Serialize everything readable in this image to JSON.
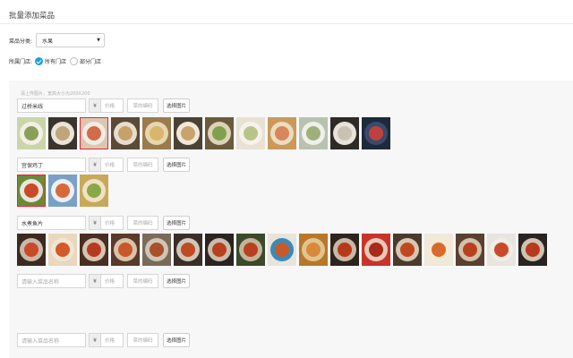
{
  "page": {
    "title": "批量添加菜品"
  },
  "category": {
    "label": "菜品分类:",
    "value": "水果"
  },
  "store": {
    "label": "所属门店:",
    "options": [
      "所有门店",
      "部分门店"
    ],
    "selected": 0
  },
  "hint": "请上传图片，宽高大小为200X200",
  "common": {
    "yen": "¥",
    "price_placeholder": "价格",
    "code_placeholder": "菜的编码",
    "pick_label": "选择图片"
  },
  "dishes": [
    {
      "name": "过桥米线",
      "placeholder": false,
      "selected_thumb": 2,
      "thumbs": [
        {
          "bg": "#c9d6a8",
          "plate": "#f2efe6",
          "food": "#8aa05a"
        },
        {
          "bg": "#3a342c",
          "plate": "#e9e4d7",
          "food": "#bfa57a"
        },
        {
          "bg": "#d8c8b0",
          "plate": "#f0ece4",
          "food": "#d36a4a"
        },
        {
          "bg": "#5b4a36",
          "plate": "#e7ddcf",
          "food": "#c8a06a"
        },
        {
          "bg": "#9a7b4e",
          "plate": "#e6d5b0",
          "food": "#d9b66a"
        },
        {
          "bg": "#4b4236",
          "plate": "#f0e8da",
          "food": "#c9a36d"
        },
        {
          "bg": "#6b5a3c",
          "plate": "#dcd2b8",
          "food": "#7fa04c"
        },
        {
          "bg": "#e8e2d4",
          "plate": "#f6f2ea",
          "food": "#b9c48a"
        },
        {
          "bg": "#c99a5a",
          "plate": "#ecdcc0",
          "food": "#d9865a"
        },
        {
          "bg": "#b8c2b0",
          "plate": "#eef0ea",
          "food": "#9fb07a"
        },
        {
          "bg": "#2e2a26",
          "plate": "#e7e3dc",
          "food": "#c9c2b0"
        },
        {
          "bg": "#1c2a3a",
          "plate": "#3a4a6a",
          "food": "#c04040"
        }
      ]
    },
    {
      "name": "宫保鸡丁",
      "placeholder": false,
      "selected_thumb": 0,
      "thumbs": [
        {
          "bg": "#6a8a3a",
          "plate": "#eae6da",
          "food": "#c84a2a"
        },
        {
          "bg": "#7aa0c8",
          "plate": "#eef0f2",
          "food": "#d86a3a"
        },
        {
          "bg": "#c8a85a",
          "plate": "#efe2c2",
          "food": "#8aa84a"
        }
      ]
    },
    {
      "name": "水煮鱼片",
      "placeholder": false,
      "selected_thumb": -1,
      "thumbs": [
        {
          "bg": "#3a2a22",
          "plate": "#c8b8a8",
          "food": "#c84a2a"
        },
        {
          "bg": "#e8d8c0",
          "plate": "#f0e6d2",
          "food": "#d45a2a"
        },
        {
          "bg": "#4a2e22",
          "plate": "#d4c4b0",
          "food": "#b83a1e"
        },
        {
          "bg": "#5a3a2a",
          "plate": "#d8c2a8",
          "food": "#c8582a"
        },
        {
          "bg": "#7a6a5a",
          "plate": "#cfc4b6",
          "food": "#a8502a"
        },
        {
          "bg": "#3a2e28",
          "plate": "#d0c6ba",
          "food": "#c04a22"
        },
        {
          "bg": "#2a2420",
          "plate": "#c8bcae",
          "food": "#b8401e"
        },
        {
          "bg": "#3a4a2a",
          "plate": "#c2b49a",
          "food": "#b8401e"
        },
        {
          "bg": "#e8e4dc",
          "plate": "#3a8ab8",
          "food": "#c85a2a"
        },
        {
          "bg": "#b8782a",
          "plate": "#e0c490",
          "food": "#d88a3a"
        },
        {
          "bg": "#2e241e",
          "plate": "#c8b8a6",
          "food": "#b83a1a"
        },
        {
          "bg": "#c8342a",
          "plate": "#e8c8b8",
          "food": "#a82a1a"
        },
        {
          "bg": "#4a3a2e",
          "plate": "#d6c6b2",
          "food": "#c04820"
        },
        {
          "bg": "#f0e8d8",
          "plate": "#f4ead6",
          "food": "#d86a2a"
        },
        {
          "bg": "#5a4030",
          "plate": "#d2c0aa",
          "food": "#b8401e"
        },
        {
          "bg": "#e8e4de",
          "plate": "#f0ece6",
          "food": "#c84a2a"
        },
        {
          "bg": "#2a2420",
          "plate": "#cfc2b2",
          "food": "#b83a1e"
        }
      ]
    },
    {
      "name": "请输入菜品名称",
      "placeholder": true,
      "selected_thumb": -1,
      "thumbs": []
    },
    {
      "name": "请输入菜品名称",
      "placeholder": true,
      "selected_thumb": -1,
      "thumbs": []
    }
  ]
}
